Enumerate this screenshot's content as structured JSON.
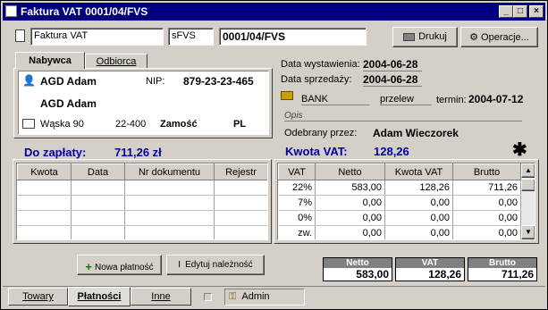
{
  "window": {
    "title": "Faktura VAT 0001/04/FVS"
  },
  "toolbar": {
    "doc_type": "Faktura VAT",
    "series": "sFVS",
    "number": "0001/04/FVS",
    "print_label": "Drukuj",
    "operations_label": "Operacje..."
  },
  "tabs": {
    "buyer": "Nabywca",
    "receiver": "Odbiorca"
  },
  "buyer": {
    "name1": "AGD Adam",
    "nip_label": "NIP:",
    "nip": "879-23-23-465",
    "name2": "AGD Adam",
    "street": "Wąska 90",
    "postal": "22-400",
    "city": "Zamość",
    "country": "PL"
  },
  "dates": {
    "issue_label": "Data wystawienia:",
    "issue": "2004-06-28",
    "sale_label": "Data sprzedaży:",
    "sale": "2004-06-28"
  },
  "payment": {
    "bank": "BANK",
    "method": "przelew",
    "term_label": "termin:",
    "term": "2004-07-12"
  },
  "desc_label": "Opis",
  "received": {
    "label": "Odebrany przez:",
    "name": "Adam Wieczorek"
  },
  "due": {
    "label": "Do zapłaty:",
    "amount": "711,26 zł"
  },
  "vat_total": {
    "label": "Kwota VAT:",
    "amount": "128,26"
  },
  "payments_table": {
    "headers": [
      "Kwota",
      "Data",
      "Nr dokumentu",
      "Rejestr"
    ]
  },
  "vat_table": {
    "headers": [
      "VAT",
      "Netto",
      "Kwota VAT",
      "Brutto"
    ],
    "rows": [
      [
        "22%",
        "583,00",
        "128,26",
        "711,26"
      ],
      [
        "7%",
        "0,00",
        "0,00",
        "0,00"
      ],
      [
        "0%",
        "0,00",
        "0,00",
        "0,00"
      ],
      [
        "zw.",
        "0,00",
        "0,00",
        "0,00"
      ]
    ]
  },
  "buttons": {
    "new_payment": "Nowa płatność",
    "edit_due": "Edytuj należność"
  },
  "totals": {
    "netto_label": "Netto",
    "netto": "583,00",
    "vat_label": "VAT",
    "vat": "128,26",
    "brutto_label": "Brutto",
    "brutto": "711,26"
  },
  "bottom_tabs": {
    "goods": "Towary",
    "payments": "Płatności",
    "other": "Inne"
  },
  "user": "Admin"
}
